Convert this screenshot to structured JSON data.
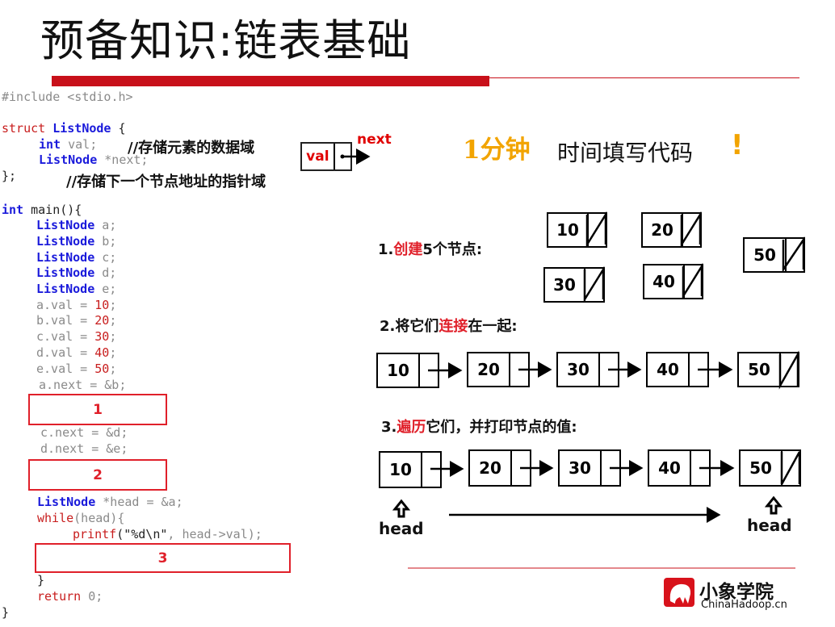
{
  "title": "预备知识:链表基础",
  "code": {
    "include": "#include <stdio.h>",
    "struct_kw": "struct",
    "struct_name": "ListNode",
    "brace_open": " {",
    "int_kw": "int",
    "val_decl": " val;",
    "val_comment": "//存储元素的数据域",
    "listnode_kw": "ListNode",
    "next_decl": " *next;",
    "struct_close": "};",
    "next_comment": "//存储下一个节点地址的指针域",
    "main_int": "int",
    "main_sig": " main(){",
    "decls": [
      "a;",
      "b;",
      "c;",
      "d;",
      "e;"
    ],
    "assigns": [
      {
        "lhs": "a.val = ",
        "num": "10",
        "end": ";"
      },
      {
        "lhs": "b.val = ",
        "num": "20",
        "end": ";"
      },
      {
        "lhs": "c.val = ",
        "num": "30",
        "end": ";"
      },
      {
        "lhs": "d.val = ",
        "num": "40",
        "end": ";"
      },
      {
        "lhs": "e.val = ",
        "num": "50",
        "end": ";"
      }
    ],
    "a_next": "a.next = &b;",
    "c_next": "c.next = &d;",
    "d_next": "d.next = &e;",
    "head_decl": " *head = &a;",
    "while_kw": "while",
    "while_rest": "(head){",
    "printf_kw": "printf",
    "printf_open": "(",
    "printf_str": "\"%d\\n\"",
    "printf_rest": ", head->val);",
    "inner_close": "}",
    "return_kw": "return",
    "return_val": " 0;",
    "main_close": "}"
  },
  "answer_boxes": [
    "1",
    "2",
    "3"
  ],
  "struct_diagram": {
    "field": "val",
    "pointer_label": "next"
  },
  "challenge": {
    "prefix": "1分钟",
    "middle": "时间填写代码",
    "suffix": "!"
  },
  "steps": [
    {
      "num": "1.",
      "red": "创建",
      "rest": "5个节点:"
    },
    {
      "num": "2.将它们",
      "red": "连接",
      "rest": "在一起:"
    },
    {
      "num": "3.",
      "red": "遍历",
      "rest": "它们，并打印节点的值:"
    }
  ],
  "node_values": [
    "10",
    "20",
    "30",
    "40",
    "50"
  ],
  "head_label": "head",
  "logo": {
    "name": "小象学院",
    "site": "ChinaHadoop.cn"
  },
  "colors": {
    "accent_red": "#c8101a",
    "keyword_blue": "#1a1adb"
  }
}
